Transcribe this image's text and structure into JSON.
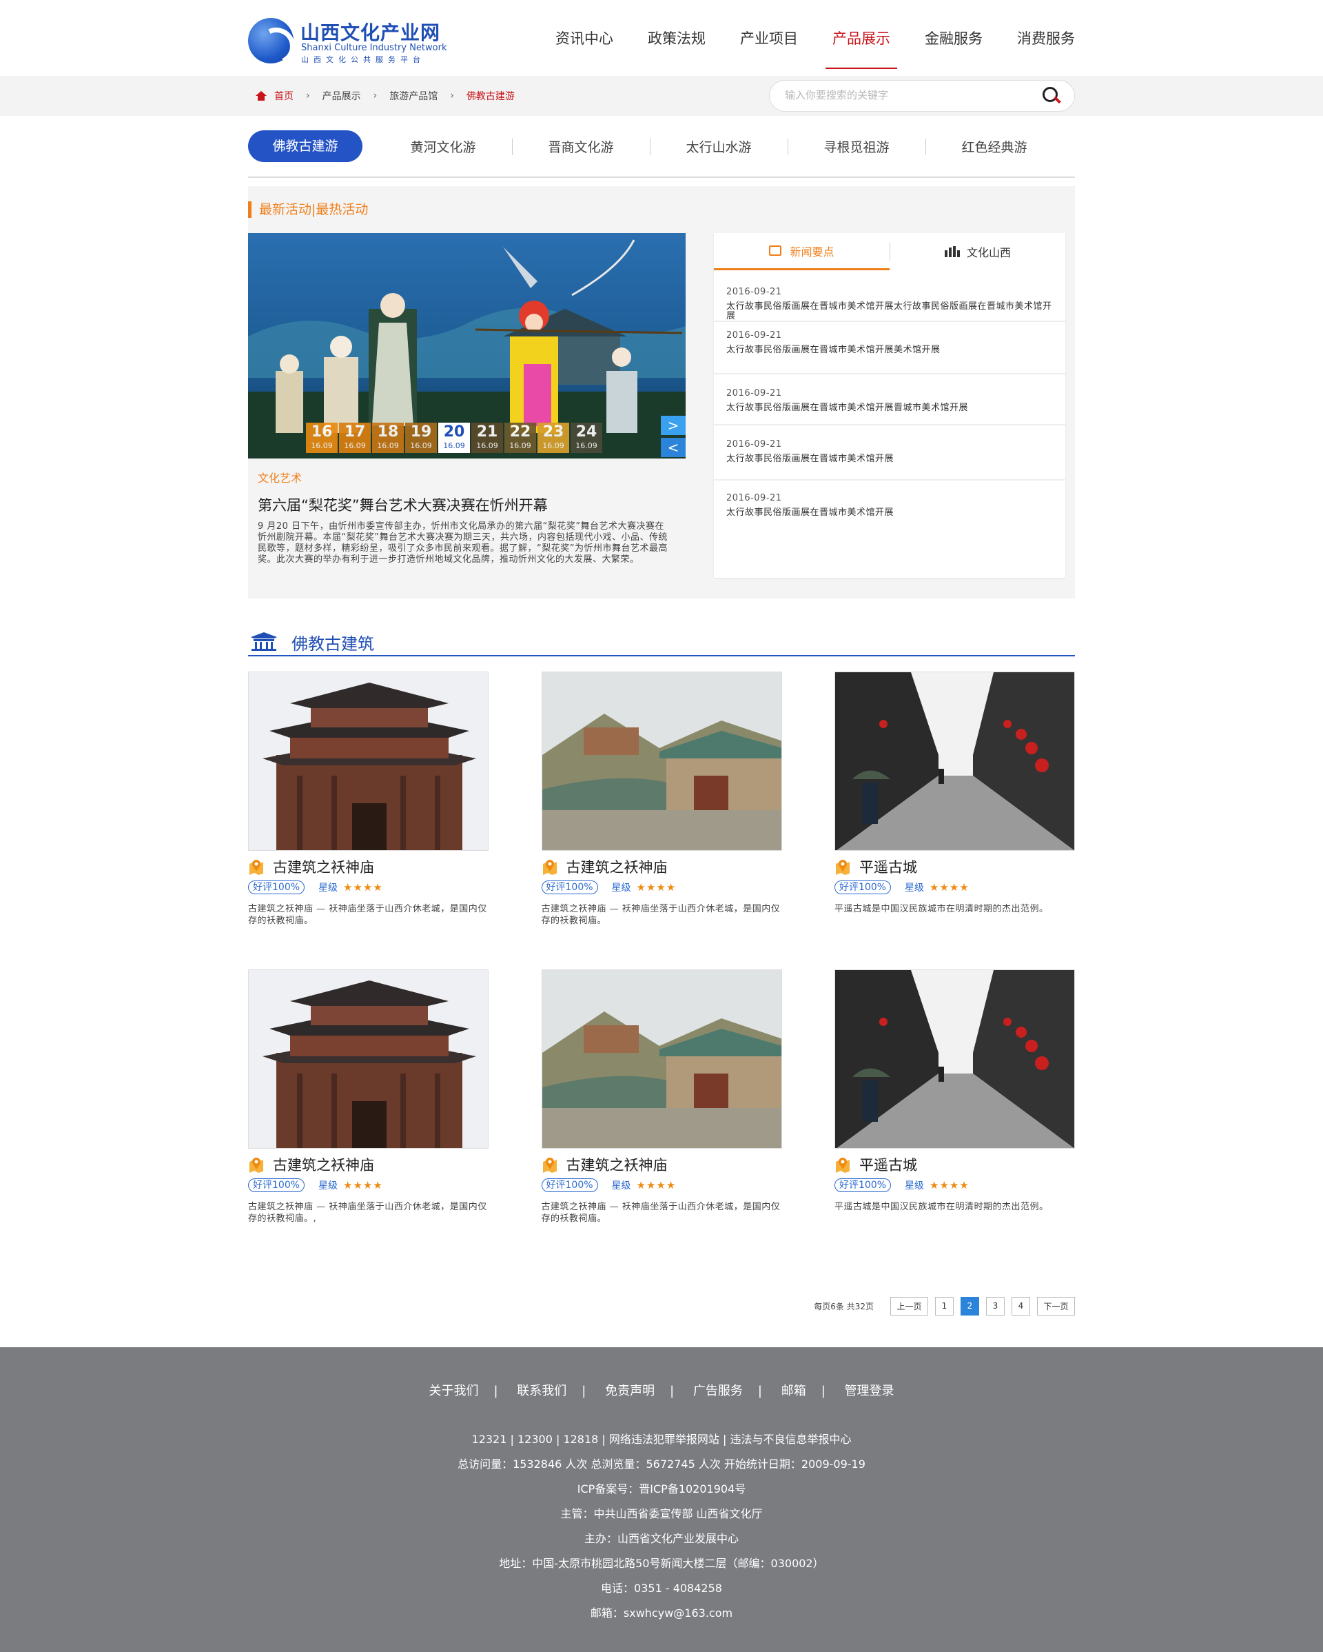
{
  "logo": {
    "cn": "山西文化产业网",
    "en": "Shanxi Culture Industry Network",
    "sub": "山西文化公共服务平台"
  },
  "nav": [
    "资讯中心",
    "政策法规",
    "产业项目",
    "产品展示",
    "金融服务",
    "消费服务"
  ],
  "nav_active_index": 3,
  "breadcrumb": {
    "home": "首页",
    "items": [
      "产品展示",
      "旅游产品馆"
    ],
    "current": "佛教古建游"
  },
  "search": {
    "placeholder": "输入你要搜索的关键字"
  },
  "categories": [
    "佛教古建游",
    "黄河文化游",
    "晋商文化游",
    "太行山水游",
    "寻根觅祖游",
    "红色经典游"
  ],
  "activities": {
    "title": "最新活动|最热活动",
    "dates": [
      {
        "d": "16",
        "m": "16.09"
      },
      {
        "d": "17",
        "m": "16.09"
      },
      {
        "d": "18",
        "m": "16.09"
      },
      {
        "d": "19",
        "m": "16.09"
      },
      {
        "d": "20",
        "m": "16.09"
      },
      {
        "d": "21",
        "m": "16.09"
      },
      {
        "d": "22",
        "m": "16.09"
      },
      {
        "d": "23",
        "m": "16.09"
      },
      {
        "d": "24",
        "m": "16.09"
      }
    ],
    "active_date_index": 4,
    "tag": "文化艺术",
    "headline": "第六届“梨花奖”舞台艺术大赛决赛在忻州开幕",
    "text": "9 月20 日下午，由忻州市委宣传部主办，忻州市文化局承办的第六届“梨花奖”舞台艺术大赛决赛在忻州剧院开幕。本届“梨花奖”舞台艺术大赛决赛为期三天，共六场，内容包括现代小戏、小品、传统民歌等，题材多样，精彩纷呈，吸引了众多市民前来观看。据了解，“梨花奖”为忻州市舞台艺术最高奖。此次大赛的举办有利于进一步打造忻州地域文化品牌，推动忻州文化的大发展、大繁荣。"
  },
  "news": {
    "tabs": [
      "新闻要点",
      "文化山西"
    ],
    "items": [
      {
        "date": "2016-09-21",
        "title": "太行故事民俗版画展在晋城市美术馆开展太行故事民俗版画展在晋城市美术馆开展"
      },
      {
        "date": "2016-09-21",
        "title": "太行故事民俗版画展在晋城市美术馆开展美术馆开展"
      },
      {
        "date": "2016-09-21",
        "title": "太行故事民俗版画展在晋城市美术馆开展晋城市美术馆开展"
      },
      {
        "date": "2016-09-21",
        "title": "太行故事民俗版画展在晋城市美术馆开展"
      },
      {
        "date": "2016-09-21",
        "title": "太行故事民俗版画展在晋城市美术馆开展"
      }
    ]
  },
  "section": {
    "title": "佛教古建筑"
  },
  "cards": [
    {
      "name": "古建筑之袄神庙",
      "rating": "好评100%",
      "star_label": "星级",
      "stars": "★★★★",
      "desc": "古建筑之袄神庙 — 袄神庙坐落于山西介休老城，是国内仅存的袄教祠庙。"
    },
    {
      "name": "古建筑之袄神庙",
      "rating": "好评100%",
      "star_label": "星级",
      "stars": "★★★★",
      "desc": "古建筑之袄神庙 — 袄神庙坐落于山西介休老城，是国内仅存的袄教祠庙。"
    },
    {
      "name": "平遥古城",
      "rating": "好评100%",
      "star_label": "星级",
      "stars": "★★★★",
      "desc": "平遥古城是中国汉民族城市在明清时期的杰出范例。"
    },
    {
      "name": "古建筑之袄神庙",
      "rating": "好评100%",
      "star_label": "星级",
      "stars": "★★★★",
      "desc": "古建筑之袄神庙 — 袄神庙坐落于山西介休老城，是国内仅存的袄教祠庙。,"
    },
    {
      "name": "古建筑之袄神庙",
      "rating": "好评100%",
      "star_label": "星级",
      "stars": "★★★★",
      "desc": "古建筑之袄神庙 — 袄神庙坐落于山西介休老城，是国内仅存的袄教祠庙。"
    },
    {
      "name": "平遥古城",
      "rating": "好评100%",
      "star_label": "星级",
      "stars": "★★★★",
      "desc": "平遥古城是中国汉民族城市在明清时期的杰出范例。"
    }
  ],
  "pager": {
    "info": "每页6条 共32页",
    "prev": "上一页",
    "pages": [
      "1",
      "2",
      "3",
      "4"
    ],
    "active_page": "2",
    "next": "下一页"
  },
  "footer": {
    "links": [
      "关于我们",
      "联系我们",
      "免责声明",
      "广告服务",
      "邮箱",
      "管理登录"
    ],
    "lines": [
      "12321 | 12300 | 12818 | 网络违法犯罪举报网站 | 违法与不良信息举报中心",
      "总访问量：1532846 人次  总浏览量：5672745 人次  开始统计日期：2009-09-19",
      "ICP备案号：晋ICP备10201904号",
      "主管：中共山西省委宣传部 山西省文化厅",
      "主办：山西省文化产业发展中心",
      "地址：中国-太原市桃园北路50号新闻大楼二层（邮编：030002）",
      "电话：0351 - 4084258",
      "邮箱：sxwhcyw@163.com"
    ]
  },
  "colors": {
    "brand_blue": "#2453c6",
    "accent_red": "#c8151b",
    "accent_orange": "#ef7f1a",
    "footer_bg": "#7a7c80"
  }
}
